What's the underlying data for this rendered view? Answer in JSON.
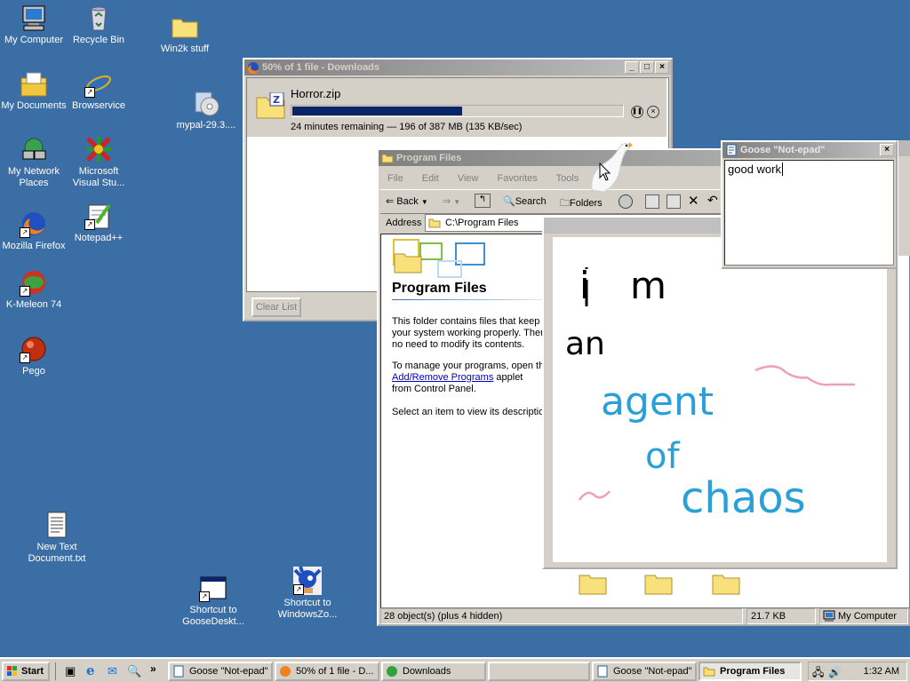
{
  "desktop": {
    "icons": [
      {
        "label": "My Computer"
      },
      {
        "label": "Recycle Bin"
      },
      {
        "label": "Win2k stuff"
      },
      {
        "label": "My Documents"
      },
      {
        "label": "Browservice"
      },
      {
        "label": "mypal-29.3...."
      },
      {
        "label": "My Network Places"
      },
      {
        "label": "Microsoft Visual Stu..."
      },
      {
        "label": "Mozilla Firefox"
      },
      {
        "label": "Notepad++"
      },
      {
        "label": "K-Meleon 74"
      },
      {
        "label": "Pego"
      },
      {
        "label": "New Text Document.txt"
      },
      {
        "label": "Shortcut to GooseDeskt..."
      },
      {
        "label": "Shortcut to WindowsZo..."
      }
    ]
  },
  "downloads": {
    "title": "50% of 1 file - Downloads",
    "filename": "Horror.zip",
    "progress": 0.5,
    "status": "24 minutes remaining — 196 of 387 MB (135 KB/sec)",
    "clear_label": "Clear List"
  },
  "explorer": {
    "title": "Program Files",
    "menu": [
      "File",
      "Edit",
      "View",
      "Favorites",
      "Tools",
      "He"
    ],
    "back_label": "Back",
    "search_label": "Search",
    "folders_label": "Folders",
    "address_label": "Address",
    "address_value": "C:\\Program Files",
    "heading": "Program Files",
    "para1": "This folder contains files that keep your system working properly. Ther no need to modify its contents.",
    "para2_pre": "To manage your programs, open th",
    "para2_link": "Add/Remove Programs",
    "para2_post": "applet from Control Panel.",
    "para3": "Select an item to view its descriptio",
    "status_objects": "28 object(s) (plus 4 hidden)",
    "status_size": "21.7 KB",
    "status_location": "My Computer"
  },
  "goose_notepad": {
    "title": "Goose \"Not-epad\"",
    "text": "good work"
  },
  "drawing": {
    "line1": "i m",
    "line2": "an",
    "line3": "agent",
    "line4": "of",
    "line5": "chaos",
    "colors": {
      "black": "#000000",
      "blue": "#2aa0d8",
      "pink": "#f0a0b0"
    }
  },
  "taskbar": {
    "start_label": "Start",
    "tasks": [
      {
        "label": "Goose \"Not-epad\""
      },
      {
        "label": "50% of 1 file - D..."
      },
      {
        "label": "Downloads"
      },
      {
        "label": ""
      },
      {
        "label": "Goose \"Not-epad\""
      },
      {
        "label": "Program Files"
      }
    ],
    "clock": "1:32 AM"
  },
  "colors": {
    "desktop": "#3a6ea5",
    "titlebar_active": "#0a246a",
    "progress": "#0a246a"
  }
}
